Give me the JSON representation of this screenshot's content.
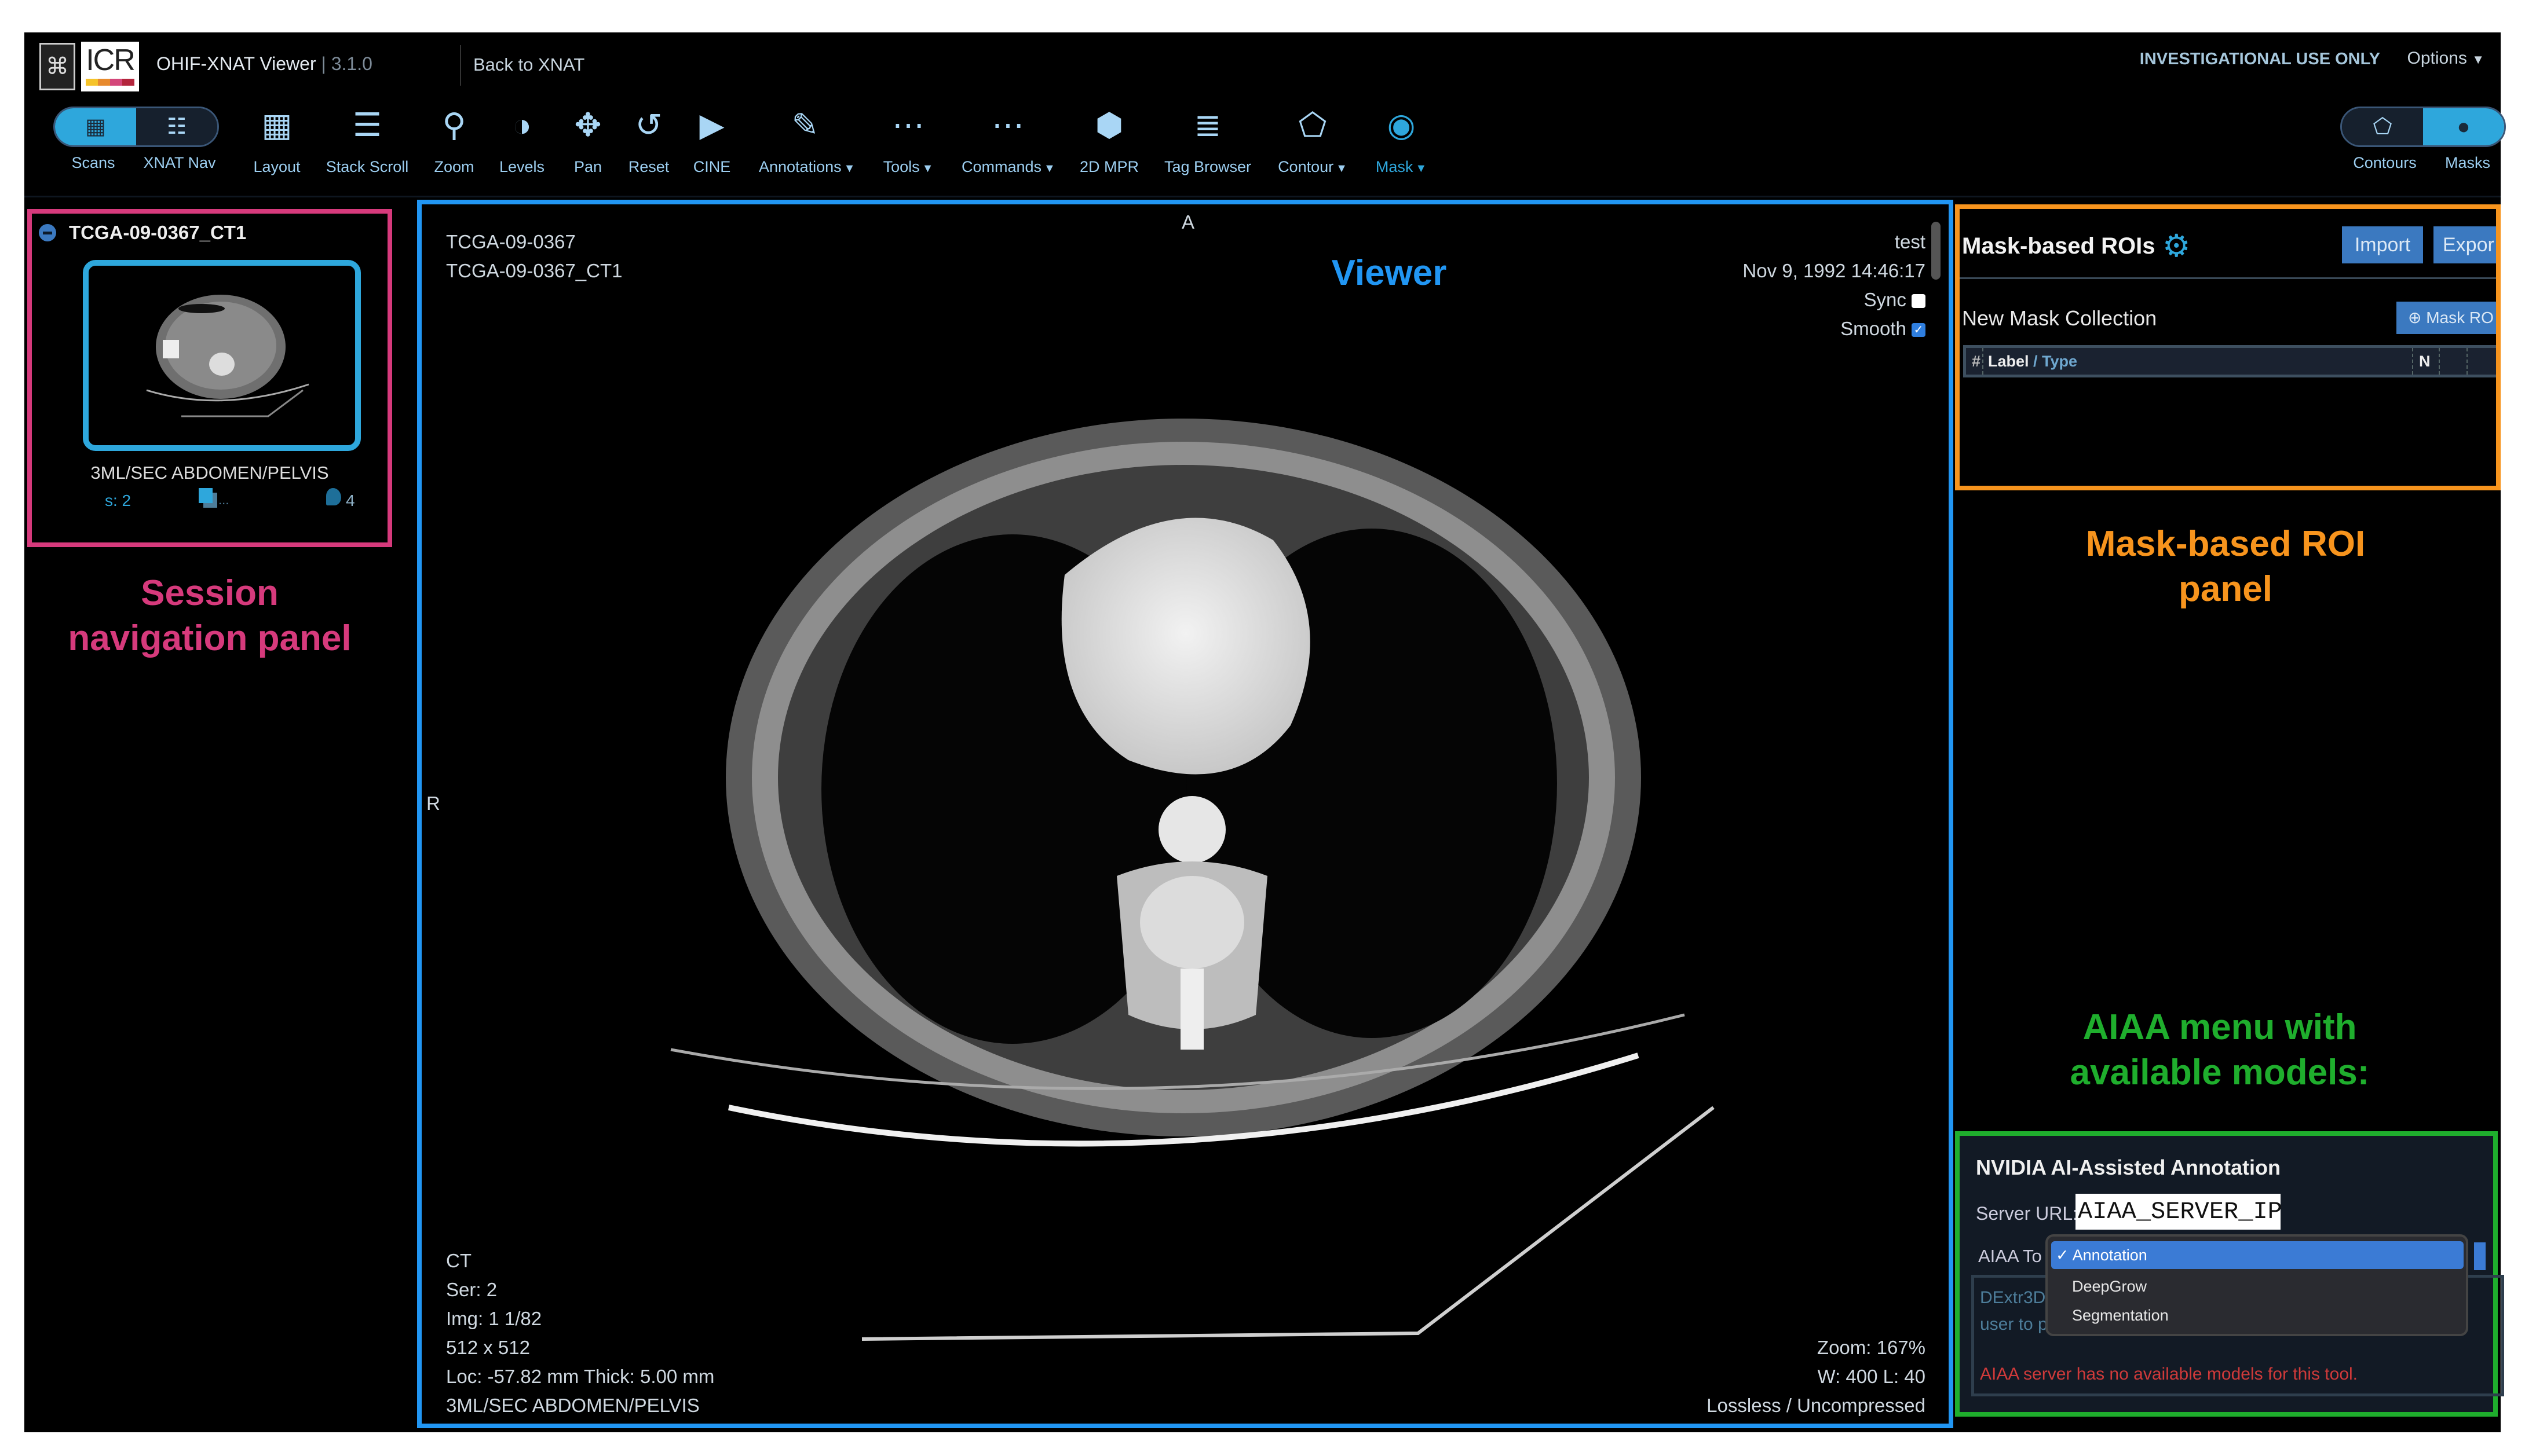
{
  "header": {
    "app_title": "OHIF-XNAT Viewer",
    "version": "3.1.0",
    "back_link": "Back to XNAT",
    "logo_text": "ICR",
    "investigational": "INVESTIGATIONAL USE ONLY",
    "options": "Options"
  },
  "toolbar": {
    "scans": "Scans",
    "xnat_nav": "XNAT Nav",
    "tools": [
      {
        "label": "Layout",
        "icon": "grid-icon"
      },
      {
        "label": "Stack Scroll",
        "icon": "stack-scroll-icon"
      },
      {
        "label": "Zoom",
        "icon": "zoom-icon"
      },
      {
        "label": "Levels",
        "icon": "levels-icon"
      },
      {
        "label": "Pan",
        "icon": "pan-icon"
      },
      {
        "label": "Reset",
        "icon": "reset-icon"
      },
      {
        "label": "CINE",
        "icon": "cine-icon"
      },
      {
        "label": "Annotations",
        "icon": "annotations-icon"
      },
      {
        "label": "Tools",
        "icon": "more-icon"
      },
      {
        "label": "Commands",
        "icon": "more-icon"
      },
      {
        "label": "2D MPR",
        "icon": "cube-icon"
      },
      {
        "label": "Tag Browser",
        "icon": "list-icon"
      },
      {
        "label": "Contour",
        "icon": "contour-icon"
      },
      {
        "label": "Mask",
        "icon": "mask-icon"
      }
    ],
    "contours": "Contours",
    "masks": "Masks"
  },
  "session_panel": {
    "session_id": "TCGA-09-0367_CT1",
    "series_description": "3ML/SEC ABDOMEN/PELVIS",
    "series_number": "s: 2",
    "roi_count": "4",
    "stack_indicator": "..."
  },
  "viewer": {
    "orientation_top": "A",
    "orientation_left": "R",
    "patient_id": "TCGA-09-0367",
    "study_id": "TCGA-09-0367_CT1",
    "top_right_name": "test",
    "study_date": "Nov 9, 1992 14:46:17",
    "sync_label": "Sync",
    "sync_checked": false,
    "smooth_label": "Smooth",
    "smooth_checked": true,
    "modality": "CT",
    "series": "Ser: 2",
    "image": "Img: 1 1/82",
    "matrix": "512 x 512",
    "location": "Loc: -57.82 mm Thick: 5.00 mm",
    "series_description": "3ML/SEC ABDOMEN/PELVIS",
    "zoom": "Zoom: 167%",
    "window_level": "W: 400 L: 40",
    "compression": "Lossless / Uncompressed"
  },
  "mask_panel": {
    "title": "Mask-based ROIs",
    "import": "Import",
    "export": "Expor",
    "collection_name": "New Mask Collection",
    "add_mask_roi": "Mask RO",
    "columns": {
      "index": "#",
      "label": "Label",
      "sep": " / ",
      "type": "Type",
      "n": "N"
    }
  },
  "aiaa_panel": {
    "title": "NVIDIA AI-Assisted Annotation",
    "server_url_label": "Server URL:",
    "server_url_value": "AIAA_SERVER_IP",
    "tool_label": "AIAA To",
    "tool_options": [
      "Annotation",
      "DeepGrow",
      "Segmentation"
    ],
    "selected_option": "Annotation",
    "description_line1": "DExtr3D",
    "description_line2": "user to p",
    "error": "AIAA server has no available models for this tool."
  },
  "annotations": {
    "viewer": "Viewer",
    "session_nav": "Session navigation panel",
    "mask_roi": "Mask-based ROI panel",
    "aiaa": "AIAA menu with available models:"
  },
  "colors": {
    "accent": "#2ea7dc",
    "session_box": "#d63a7c",
    "viewer_box": "#2196f3",
    "mask_box": "#f7941d",
    "aiaa_box": "#1fae2d",
    "error": "#d03a3a"
  }
}
